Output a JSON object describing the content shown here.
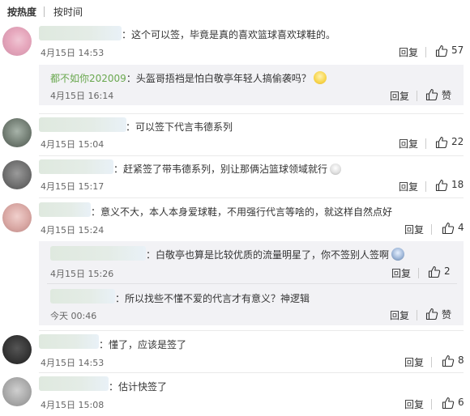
{
  "sort": {
    "hot": "按热度",
    "time": "按时间"
  },
  "actions": {
    "reply": "回复",
    "like": "赞"
  },
  "comments": [
    {
      "text": "：这个可以签，毕竟是真的喜欢篮球喜欢球鞋的。",
      "time": "4月15日 14:53",
      "likes": "57"
    },
    {
      "text": "：可以签下代言韦德系列",
      "time": "4月15日 15:04",
      "likes": "22"
    },
    {
      "text": "：赶紧签了带韦德系列，别让那俩沾篮球领域就行",
      "time": "4月15日 15:17",
      "likes": "18"
    },
    {
      "text": "：意义不大，本人本身爱球鞋，不用强行代言等啥的，就这样自然点好",
      "time": "4月15日 15:24",
      "likes": "4"
    },
    {
      "text": "：懂了，应该是签了",
      "time": "4月15日 14:53",
      "likes": "8"
    },
    {
      "text": "：估计快签了",
      "time": "4月15日 15:08",
      "likes": "6"
    }
  ],
  "replies": [
    {
      "name": "都不如你202009",
      "text": "：头盔哥捂裆是怕白敬亭年轻人搞偷袭吗？",
      "time": "4月15日 16:14",
      "likes": "赞"
    },
    {
      "name": "",
      "text": "：白敬亭也算是比较优质的流量明星了，你不签别人签啊",
      "time": "4月15日 15:26",
      "likes": "2"
    },
    {
      "name": "",
      "text": "：所以找些不懂不爱的代言才有意义？神逻辑",
      "time": "今天 00:46",
      "likes": "赞"
    }
  ]
}
